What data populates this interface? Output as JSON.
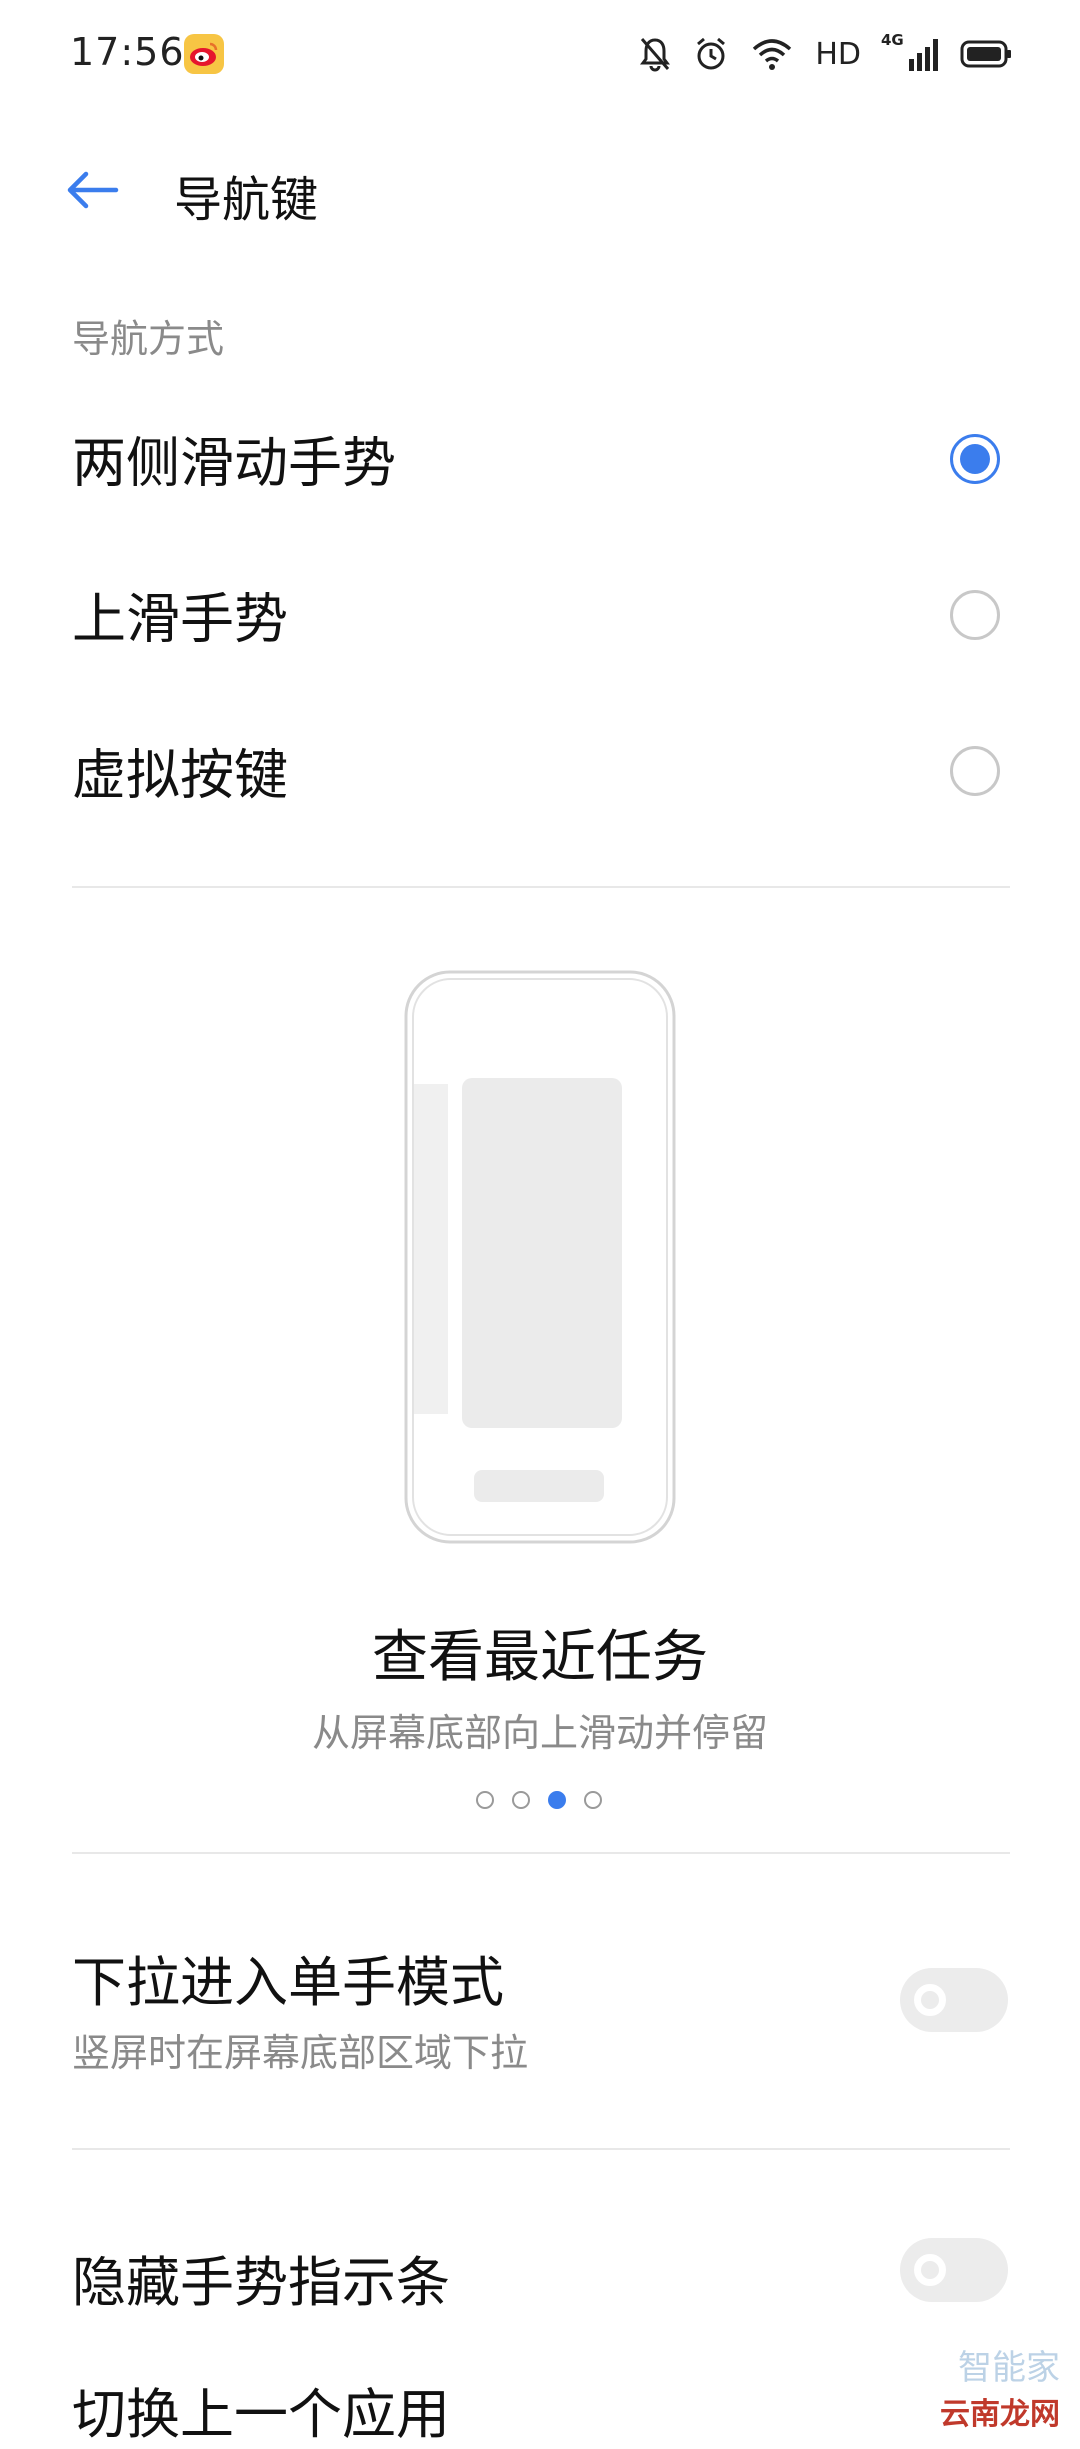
{
  "status_bar": {
    "time": "17:56",
    "network_label": "HD",
    "network_gen": "4G",
    "icons": [
      "weibo-icon",
      "mute-bell-icon",
      "alarm-icon",
      "wifi-icon",
      "signal-icon",
      "battery-icon"
    ]
  },
  "header": {
    "title": "导航键"
  },
  "navigation_section": {
    "label": "导航方式",
    "options": [
      {
        "label": "两侧滑动手势",
        "selected": true
      },
      {
        "label": "上滑手势",
        "selected": false
      },
      {
        "label": "虚拟按键",
        "selected": false
      }
    ]
  },
  "illustration": {
    "title": "查看最近任务",
    "subtitle": "从屏幕底部向上滑动并停留",
    "page_count": 4,
    "active_page": 3
  },
  "settings": [
    {
      "title": "下拉进入单手模式",
      "subtitle": "竖屏时在屏幕底部区域下拉",
      "enabled": false
    },
    {
      "title": "隐藏手势指示条",
      "enabled": false
    }
  ],
  "partial_row": {
    "text": "切换上一个应用"
  },
  "watermark": {
    "top": "智能家",
    "bottom": "云南龙网"
  },
  "colors": {
    "accent": "#3b7ded",
    "text_primary": "#111111",
    "text_secondary": "#8a8a8a",
    "divider": "#e8e8e8"
  }
}
